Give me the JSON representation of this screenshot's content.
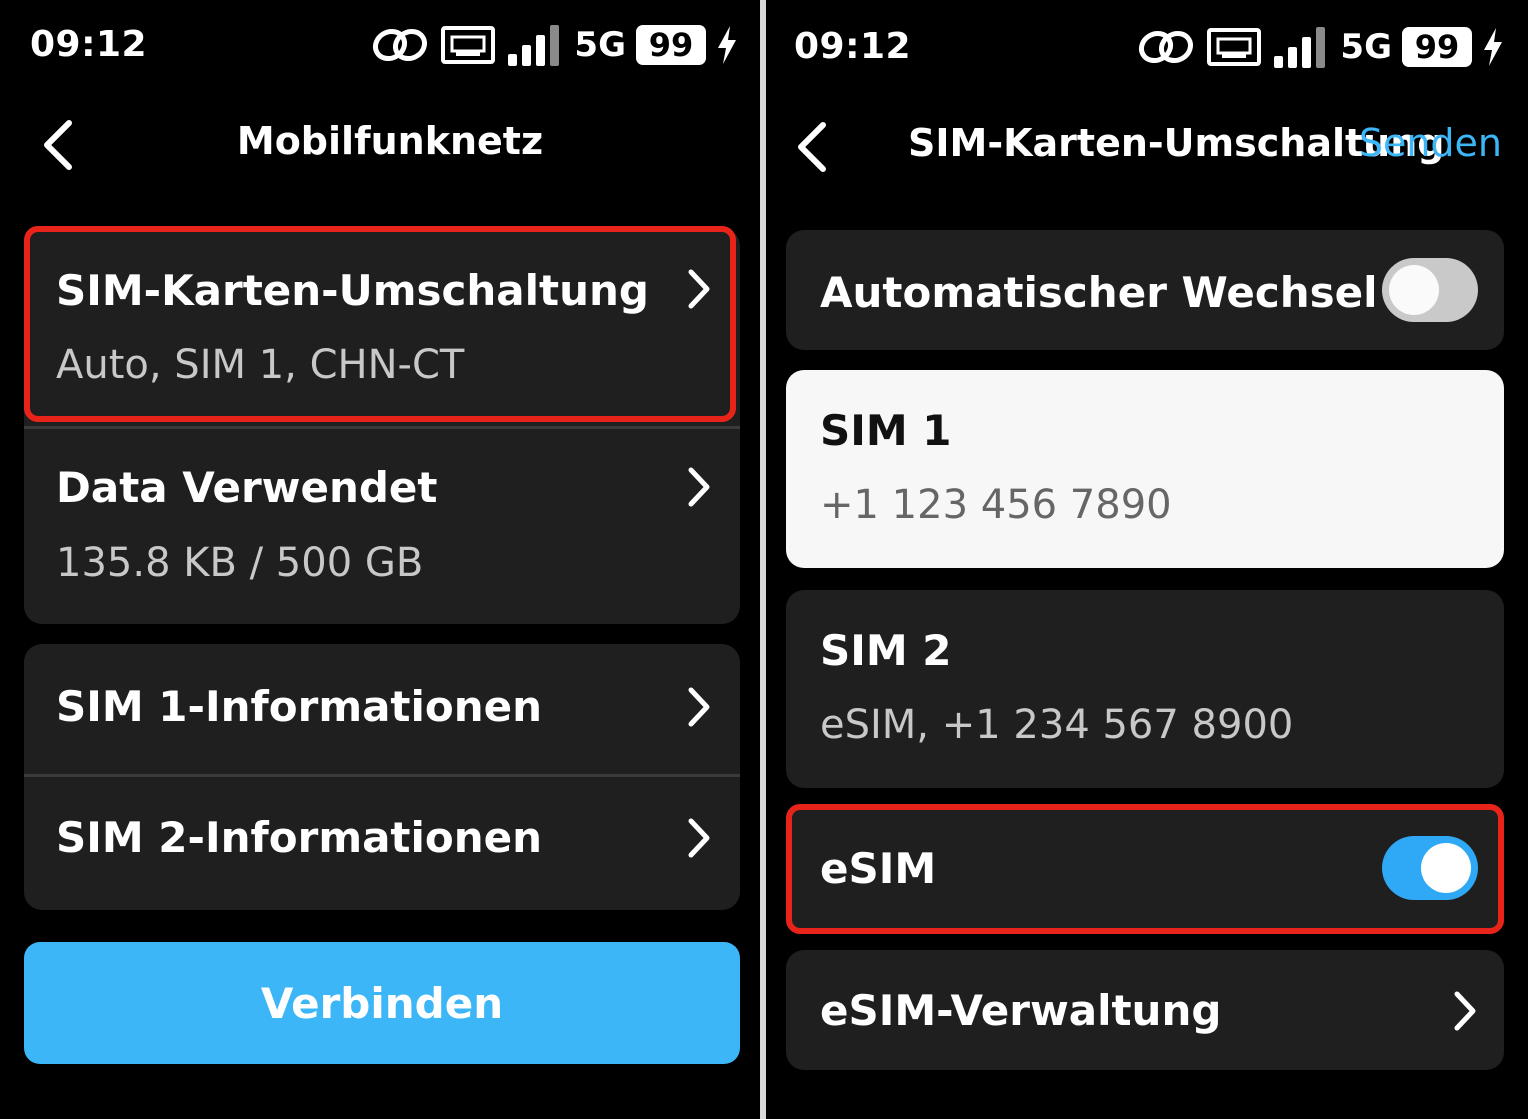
{
  "left": {
    "status": {
      "time": "09:12",
      "network": "5G",
      "battery": "99"
    },
    "header": {
      "title": "Mobilfunknetz"
    },
    "items": [
      {
        "title": "SIM-Karten-Umschaltung",
        "subtitle": "Auto, SIM 1, CHN-CT"
      },
      {
        "title": "Data Verwendet",
        "subtitle": "135.8 KB / 500 GB"
      },
      {
        "title": "SIM 1-Informationen"
      },
      {
        "title": "SIM 2-Informationen"
      }
    ],
    "button_label": "Verbinden"
  },
  "right": {
    "status": {
      "time": "09:12",
      "network": "5G",
      "battery": "99"
    },
    "header": {
      "title": "SIM-Karten-Umschaltung",
      "action": "Senden"
    },
    "auto_switch": {
      "label": "Automatischer Wechsel",
      "enabled": false
    },
    "sim1": {
      "title": "SIM 1",
      "number": "+1 123 456 7890",
      "selected": true
    },
    "sim2": {
      "title": "SIM 2",
      "number": "eSIM, +1 234 567 8900",
      "selected": false
    },
    "esim": {
      "label": "eSIM",
      "enabled": true
    },
    "esim_management": {
      "label": "eSIM-Verwaltung"
    }
  },
  "colors": {
    "accent": "#3cb6f6",
    "highlight": "#e8241a",
    "card": "#1f1f1f",
    "background": "#000000"
  },
  "icons": [
    "link-icon",
    "ethernet-icon",
    "signal-icon",
    "charging-icon",
    "back-arrow-icon",
    "chevron-right-icon"
  ]
}
